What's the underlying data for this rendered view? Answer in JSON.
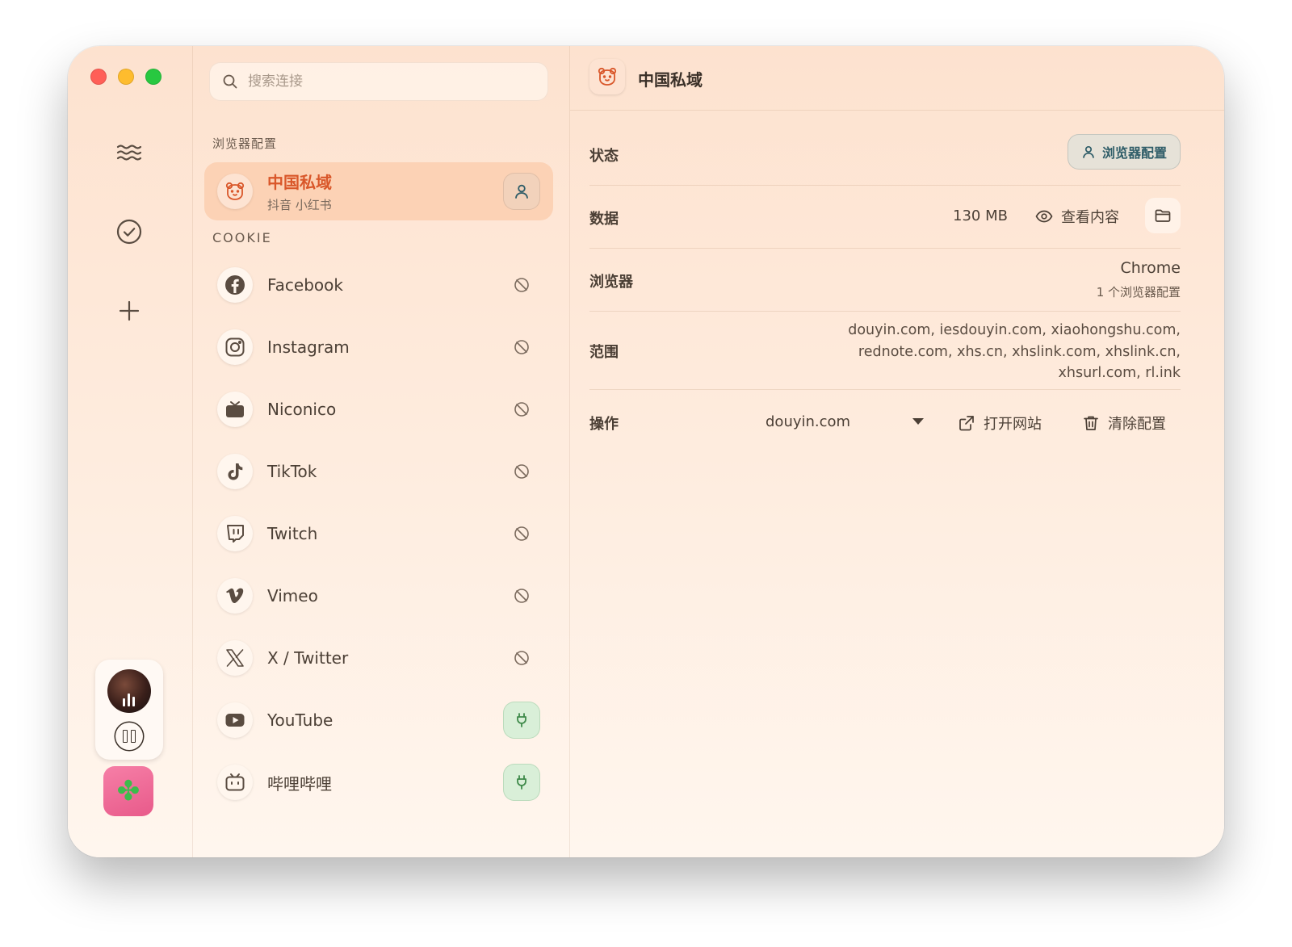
{
  "search": {
    "placeholder": "搜索连接"
  },
  "sections": {
    "browser_profiles": "浏览器配置",
    "cookie": "COOKIE"
  },
  "active_profile": {
    "name": "中国私域",
    "subtitle": "抖音 小红书"
  },
  "cookie_items": [
    {
      "label": "Facebook",
      "icon": "facebook-icon",
      "status": "disconnected"
    },
    {
      "label": "Instagram",
      "icon": "instagram-icon",
      "status": "disconnected"
    },
    {
      "label": "Niconico",
      "icon": "tv-icon",
      "status": "disconnected"
    },
    {
      "label": "TikTok",
      "icon": "tiktok-icon",
      "status": "disconnected"
    },
    {
      "label": "Twitch",
      "icon": "twitch-icon",
      "status": "disconnected"
    },
    {
      "label": "Vimeo",
      "icon": "vimeo-icon",
      "status": "disconnected"
    },
    {
      "label": "X / Twitter",
      "icon": "x-icon",
      "status": "disconnected"
    },
    {
      "label": "YouTube",
      "icon": "youtube-icon",
      "status": "connected"
    },
    {
      "label": "哔哩哔哩",
      "icon": "bilibili-icon",
      "status": "connected"
    }
  ],
  "detail": {
    "title": "中国私域",
    "status": {
      "label": "状态",
      "button": "浏览器配置"
    },
    "data": {
      "label": "数据",
      "size": "130 MB",
      "view_button": "查看内容"
    },
    "browser": {
      "label": "浏览器",
      "name": "Chrome",
      "profiles": "1 个浏览器配置"
    },
    "scope": {
      "label": "范围",
      "lines": [
        "douyin.com, iesdouyin.com, xiaohongshu.com,",
        "rednote.com, xhs.cn, xhslink.com, xhslink.cn,",
        "xhsurl.com, rl.ink"
      ]
    },
    "actions": {
      "label": "操作",
      "selected_domain": "douyin.com",
      "open_site": "打开网站",
      "clear_profile": "清除配置"
    }
  },
  "colors": {
    "accent": "#d9572a",
    "connected": "#3f8a4a",
    "profile_button": "#2f5d68"
  }
}
